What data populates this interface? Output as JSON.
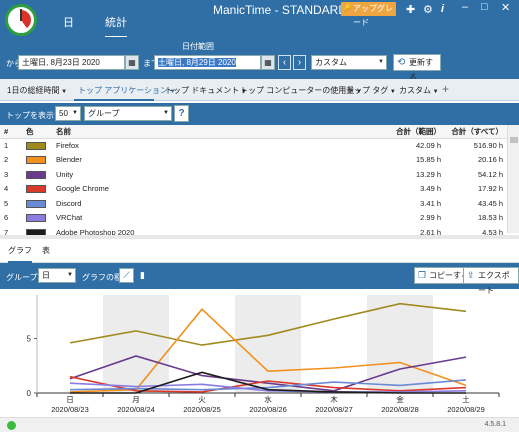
{
  "app": {
    "title": "ManicTime - STANDARD",
    "nav_tabs": [
      "日",
      "統計"
    ],
    "upgrade_label": "アップグレード",
    "version": "4.5.8.1"
  },
  "date_range": {
    "caption": "日付範囲",
    "from_label": "から",
    "from_value": "土曜日, 8月23日 2020",
    "to_label": "まで",
    "to_value": "土曜日, 8月29日 2020",
    "preset": "カスタム",
    "refresh_label": "更新する"
  },
  "report_tabs": [
    "1日の総経時間",
    "トップ アプリケーション",
    "トップ ドキュメント",
    "トップ コンピューターの使用量",
    "トップ タグ",
    "カスタム"
  ],
  "filter": {
    "top_label": "トップを表示する",
    "top_value": "50",
    "group_value": "グループ",
    "help": "?"
  },
  "table": {
    "headers": [
      "#",
      "色",
      "名前",
      "合計（範囲）",
      "合計（すべて）"
    ],
    "rows": [
      {
        "n": "1",
        "color": "#a08a1e",
        "name": "Firefox",
        "range": "42.09 h",
        "all": "516.90 h"
      },
      {
        "n": "2",
        "color": "#f2901e",
        "name": "Blender",
        "range": "15.85 h",
        "all": "20.16 h"
      },
      {
        "n": "3",
        "color": "#6a3a8c",
        "name": "Unity",
        "range": "13.29 h",
        "all": "54.12 h"
      },
      {
        "n": "4",
        "color": "#d93a2b",
        "name": "Google Chrome",
        "range": "3.49 h",
        "all": "17.92 h"
      },
      {
        "n": "5",
        "color": "#6a8ad6",
        "name": "Discord",
        "range": "3.41 h",
        "all": "43.45 h"
      },
      {
        "n": "6",
        "color": "#8a7ce0",
        "name": "VRChat",
        "range": "2.99 h",
        "all": "18.53 h"
      },
      {
        "n": "7",
        "color": "#1c1c1c",
        "name": "Adobe Photoshop 2020",
        "range": "2.61 h",
        "all": "4.53 h"
      }
    ]
  },
  "bottom_tabs": [
    "グラフ",
    "表"
  ],
  "graph_toolbar": {
    "group_label": "グループ名",
    "group_value": "日",
    "type_label": "グラフの種類",
    "copy_label": "コピーする",
    "export_label": "エクスポート"
  },
  "chart_data": {
    "type": "line",
    "x": [
      "2020/08/23",
      "2020/08/24",
      "2020/08/25",
      "2020/08/26",
      "2020/08/27",
      "2020/08/28",
      "2020/08/29"
    ],
    "x_day_labels": [
      "日",
      "月",
      "火",
      "水",
      "木",
      "金",
      "土"
    ],
    "y_ticks": [
      "0",
      "5"
    ],
    "ylim": [
      0,
      9
    ],
    "shaded_columns": [
      1,
      3,
      5
    ],
    "series": [
      {
        "name": "Firefox",
        "color": "#a08a1e",
        "values": [
          4.6,
          5.7,
          4.4,
          5.3,
          6.8,
          8.2,
          7.5
        ]
      },
      {
        "name": "Blender",
        "color": "#f2901e",
        "values": [
          0.1,
          0.3,
          7.7,
          2.0,
          2.3,
          2.8,
          0.7
        ]
      },
      {
        "name": "Unity",
        "color": "#6a3a8c",
        "values": [
          1.3,
          3.4,
          1.6,
          0.9,
          0.2,
          2.2,
          3.3
        ]
      },
      {
        "name": "Google Chrome",
        "color": "#d93a2b",
        "values": [
          1.5,
          0.2,
          0.1,
          1.1,
          0.5,
          0.2,
          0.5
        ]
      },
      {
        "name": "Discord",
        "color": "#6a8ad6",
        "values": [
          0.3,
          0.4,
          0.3,
          0.5,
          1.0,
          0.7,
          1.2
        ]
      },
      {
        "name": "VRChat",
        "color": "#8a7ce0",
        "values": [
          0.9,
          0.6,
          0.8,
          0.2,
          0.1,
          0.1,
          0.2
        ]
      },
      {
        "name": "Adobe Photoshop 2020",
        "color": "#1c1c1c",
        "values": [
          0.0,
          0.0,
          1.9,
          0.3,
          0.1,
          0.0,
          0.0
        ]
      }
    ]
  }
}
